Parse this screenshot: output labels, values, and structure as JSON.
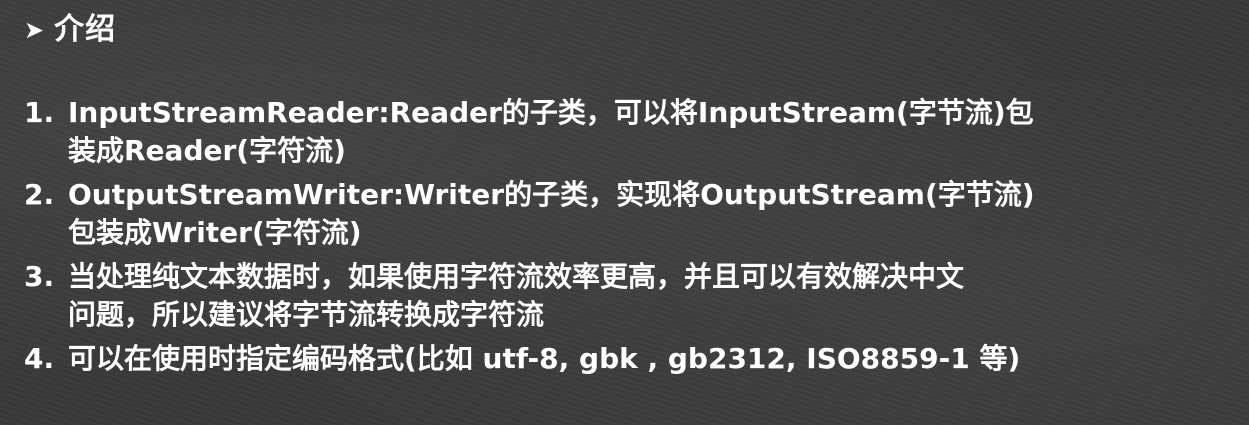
{
  "slide": {
    "bullet_icon": "triangle-right-icon",
    "title": "介绍",
    "items": [
      {
        "number": "1.",
        "line1": "InputStreamReader:Reader的子类，可以将InputStream(字节流)包",
        "line2": "装成Reader(字符流)"
      },
      {
        "number": "2.",
        "line1": "OutputStreamWriter:Writer的子类，实现将OutputStream(字节流)",
        "line2": "包装成Writer(字符流)"
      },
      {
        "number": "3.",
        "line1": "当处理纯文本数据时，如果使用字符流效率更高，并且可以有效解决中文",
        "line2": "问题，所以建议将字节流转换成字符流"
      },
      {
        "number": "4.",
        "line1": "可以在使用时指定编码格式(比如 utf-8, gbk , gb2312, ISO8859-1 等)"
      }
    ]
  },
  "colors": {
    "background": "#3a3a3a",
    "text": "#ffffff"
  }
}
